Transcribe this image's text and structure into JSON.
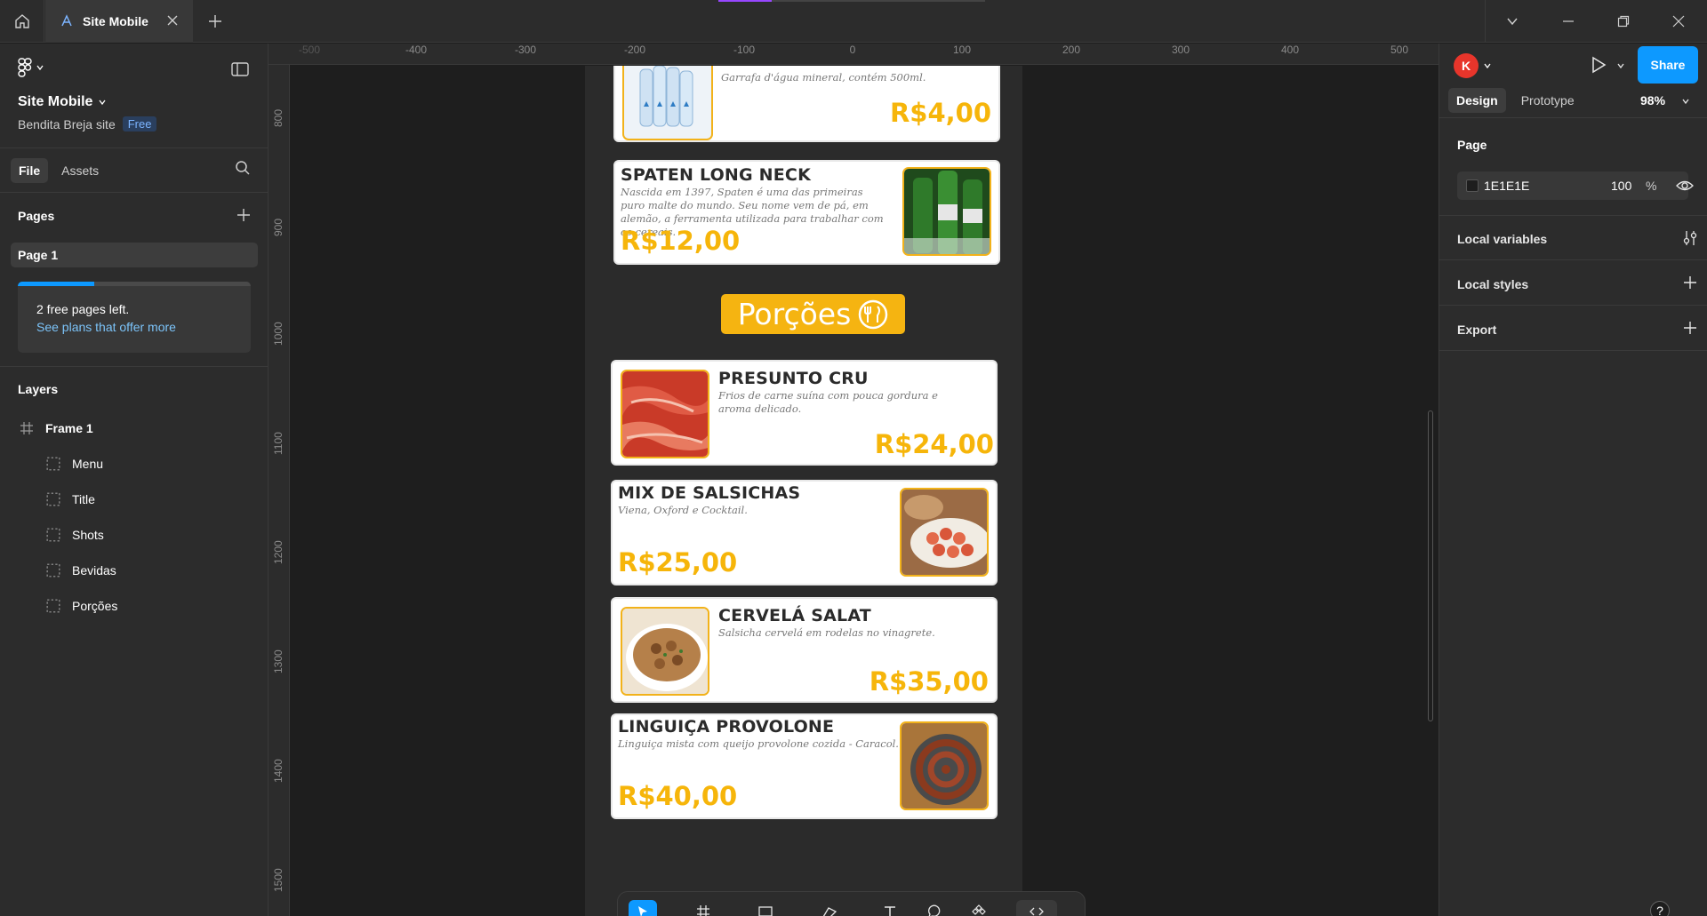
{
  "tabbar": {
    "tab_label": "Site Mobile",
    "icons": [
      "home-icon",
      "figma-file-icon",
      "close-icon",
      "plus-icon",
      "chevron-down-icon",
      "minimize-icon",
      "restore-icon",
      "close-window-icon"
    ]
  },
  "file": {
    "title": "Site Mobile",
    "project": "Bendita Breja site",
    "plan_badge": "Free"
  },
  "left_tabs": [
    "File",
    "Assets"
  ],
  "pages": {
    "title": "Pages",
    "items": [
      "Page 1"
    ],
    "upsell_line1": "2 free pages left.",
    "upsell_link": "See plans that offer more",
    "progress": 0.33
  },
  "layers": {
    "title": "Layers",
    "root": "Frame 1",
    "children": [
      "Menu",
      "Title",
      "Shots",
      "Bevidas",
      "Porções"
    ]
  },
  "ruler": {
    "top": [
      "-500",
      "-400",
      "-300",
      "-200",
      "-100",
      "0",
      "100",
      "200",
      "300",
      "400",
      "500"
    ],
    "left": [
      "800",
      "900",
      "1000",
      "1100",
      "1200",
      "1300",
      "1400",
      "1500"
    ]
  },
  "canvas": {
    "section_label": "Porções",
    "products": [
      {
        "name": "",
        "desc": "Garrafa d'água mineral, contém 500ml.",
        "price": "R$4,00"
      },
      {
        "name": "SPATEN LONG NECK",
        "desc": "Nascida em 1397, Spaten é uma das primeiras puro malte do mundo. Seu nome vem de pá, em alemão, a ferramenta utilizada para trabalhar com os cereais.",
        "price": "R$12,00"
      },
      {
        "name": "PRESUNTO CRU",
        "desc": "Frios de carne suína com pouca gordura e aroma delicado.",
        "price": "R$24,00"
      },
      {
        "name": "MIX DE SALSICHAS",
        "desc": "Viena, Oxford e Cocktail.",
        "price": "R$25,00"
      },
      {
        "name": "CERVELÁ SALAT",
        "desc": "Salsicha cervelá em rodelas no vinagrete.",
        "price": "R$35,00"
      },
      {
        "name": "LINGUIÇA PROVOLONE",
        "desc": "Linguiça mista com queijo provolone cozida - Caracol.",
        "price": "R$40,00"
      }
    ]
  },
  "right": {
    "avatar_initial": "K",
    "share_label": "Share",
    "tabs": [
      "Design",
      "Prototype"
    ],
    "zoom": "98%",
    "page_title": "Page",
    "page_color": "1E1E1E",
    "page_opacity": "100",
    "percent_sign": "%",
    "local_variables": "Local variables",
    "local_styles": "Local styles",
    "export": "Export"
  },
  "colors": {
    "accent": "#0d99ff",
    "price_yellow": "#f6b50a",
    "avatar_red": "#e8352b",
    "canvas_bg": "#1E1E1E"
  },
  "help_label": "?"
}
